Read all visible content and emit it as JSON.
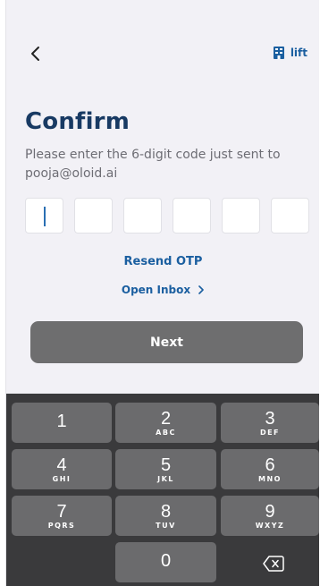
{
  "header": {
    "back_icon": "chevron-left-icon",
    "brand_label": "lift",
    "brand_icon": "building-icon",
    "brand_color": "#1b5fa0"
  },
  "confirm": {
    "title": "Confirm",
    "subtitle": "Please enter the 6-digit code just sent to pooja@oloid.ai",
    "otp_digits": [
      "",
      "",
      "",
      "",
      "",
      ""
    ],
    "resend_label": "Resend OTP",
    "inbox_label": "Open Inbox",
    "next_label": "Next"
  },
  "keyboard": {
    "keys": [
      {
        "num": "1",
        "letters": ""
      },
      {
        "num": "2",
        "letters": "ABC"
      },
      {
        "num": "3",
        "letters": "DEF"
      },
      {
        "num": "4",
        "letters": "GHI"
      },
      {
        "num": "5",
        "letters": "JKL"
      },
      {
        "num": "6",
        "letters": "MNO"
      },
      {
        "num": "7",
        "letters": "PQRS"
      },
      {
        "num": "8",
        "letters": "TUV"
      },
      {
        "num": "9",
        "letters": "WXYZ"
      },
      {
        "num": "0",
        "letters": ""
      }
    ],
    "delete_icon": "backspace-icon"
  },
  "colors": {
    "accent": "#1b5fa0",
    "title": "#183a63",
    "button_disabled": "#6e6e6f",
    "keyboard_bg": "#3a3a3c",
    "key_bg": "#6b6b6d"
  }
}
